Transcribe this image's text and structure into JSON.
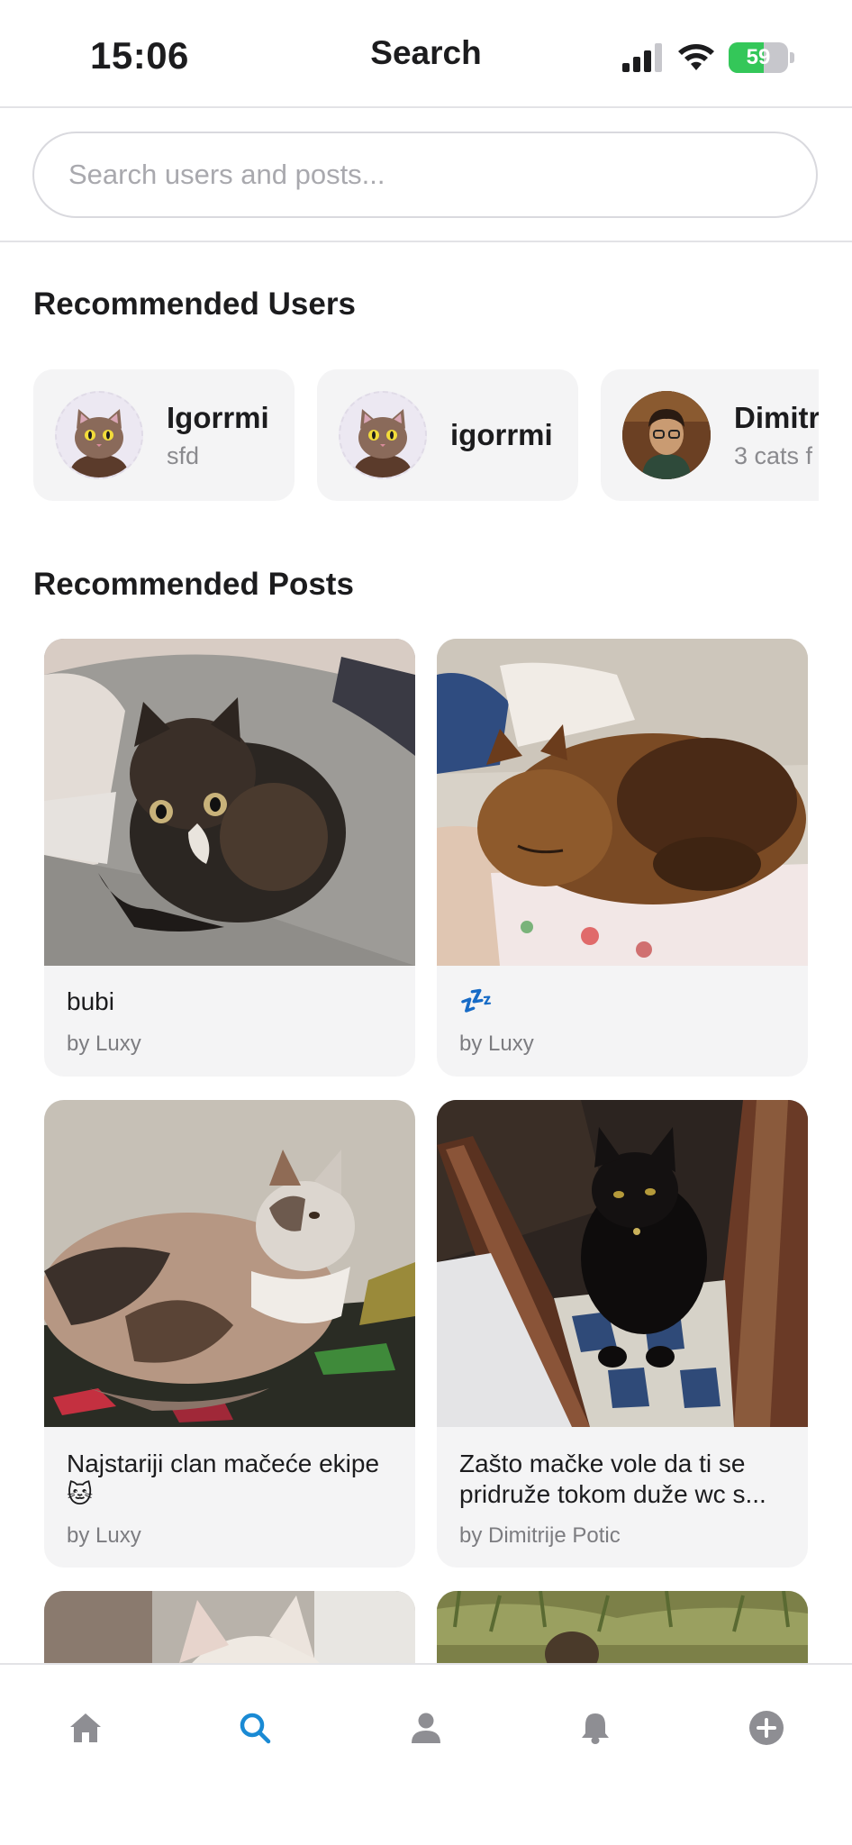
{
  "status_bar": {
    "time": "15:06",
    "battery_percent": 59
  },
  "header": {
    "title": "Search"
  },
  "search": {
    "placeholder": "Search users and posts...",
    "value": ""
  },
  "recommended_users": {
    "title": "Recommended Users",
    "users": [
      {
        "name": "Igorrmi",
        "subtitle": "sfd"
      },
      {
        "name": "igorrmi",
        "subtitle": ""
      },
      {
        "name": "Dimitr",
        "subtitle": "3 cats f"
      }
    ]
  },
  "recommended_posts": {
    "title": "Recommended Posts",
    "posts": [
      {
        "caption": "bubi",
        "author": "by Luxy"
      },
      {
        "caption": "💤",
        "author": "by Luxy"
      },
      {
        "caption": "Najstariji clan mačeće ekipe 🐱",
        "author": "by Luxy"
      },
      {
        "caption": "Zašto mačke vole da ti se pridruže tokom duže wc s...",
        "author": "by Dimitrije Potic"
      },
      {
        "caption": "",
        "author": ""
      },
      {
        "caption": "",
        "author": ""
      }
    ]
  },
  "tab_bar": {
    "active": "search",
    "tabs": [
      {
        "icon": "home-icon"
      },
      {
        "icon": "search-icon"
      },
      {
        "icon": "profile-icon"
      },
      {
        "icon": "bell-icon"
      },
      {
        "icon": "plus-icon"
      }
    ]
  },
  "colors": {
    "accent": "#1a8ad4",
    "tab_inactive": "#8e8e93",
    "card_bg": "#f4f4f5",
    "battery_green": "#34c759"
  }
}
